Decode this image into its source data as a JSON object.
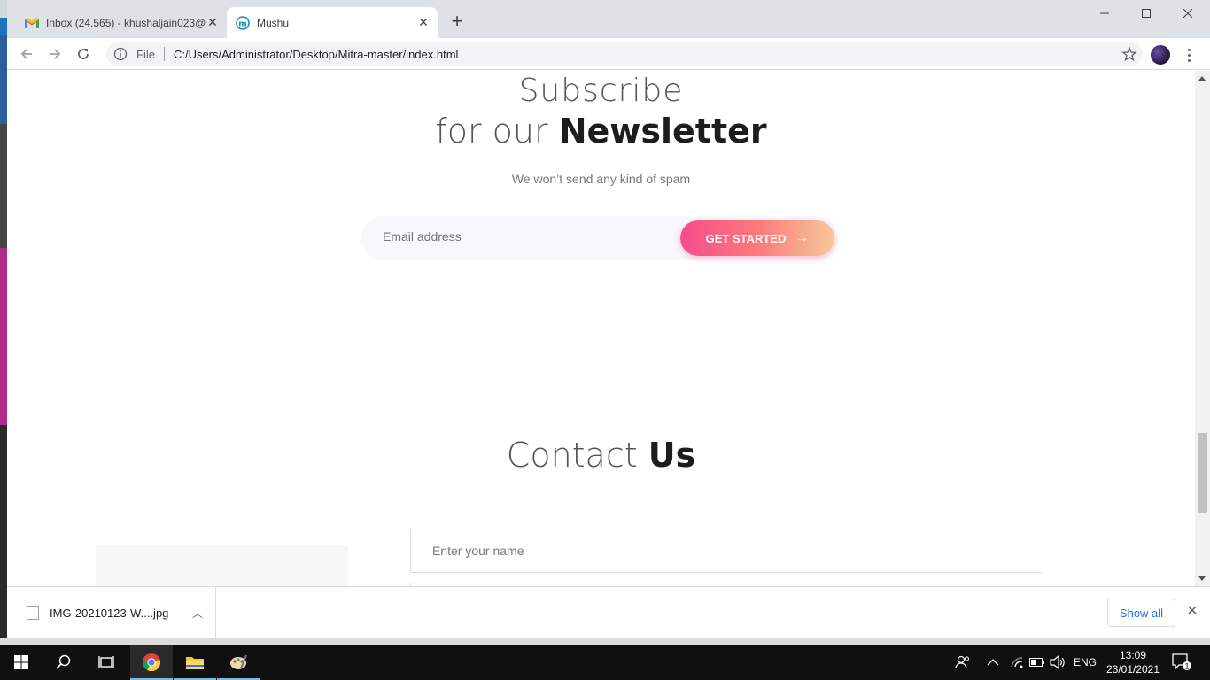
{
  "browser": {
    "tabs": [
      {
        "title": "Inbox (24,565) - khushaljain023@",
        "favicon": "gmail-icon",
        "active": false
      },
      {
        "title": "Mushu",
        "favicon": "mushu-icon",
        "active": true
      }
    ],
    "omnibox": {
      "scheme": "File",
      "url": "C:/Users/Administrator/Desktop/Mitra-master/index.html"
    }
  },
  "page": {
    "newsletter": {
      "line1": "Subscribe",
      "line2_light": "for our ",
      "line2_bold": "Newsletter",
      "subtitle": "We won’t send any kind of spam",
      "email_placeholder": "Email address",
      "button_label": "GET STARTED",
      "button_arrow": "→"
    },
    "contact": {
      "title_light": "Contact ",
      "title_bold": "Us",
      "name_placeholder": "Enter your name"
    }
  },
  "downloads": {
    "file_name": "IMG-20210123-W....jpg",
    "show_all_label": "Show all"
  },
  "taskbar": {
    "language": "ENG",
    "time": "13:09",
    "date": "23/01/2021",
    "notification_count": "1"
  },
  "colors": {
    "accent_gradient_start": "#f74b8c",
    "accent_gradient_end": "#f7c89a",
    "show_all_link": "#1a73e8"
  }
}
